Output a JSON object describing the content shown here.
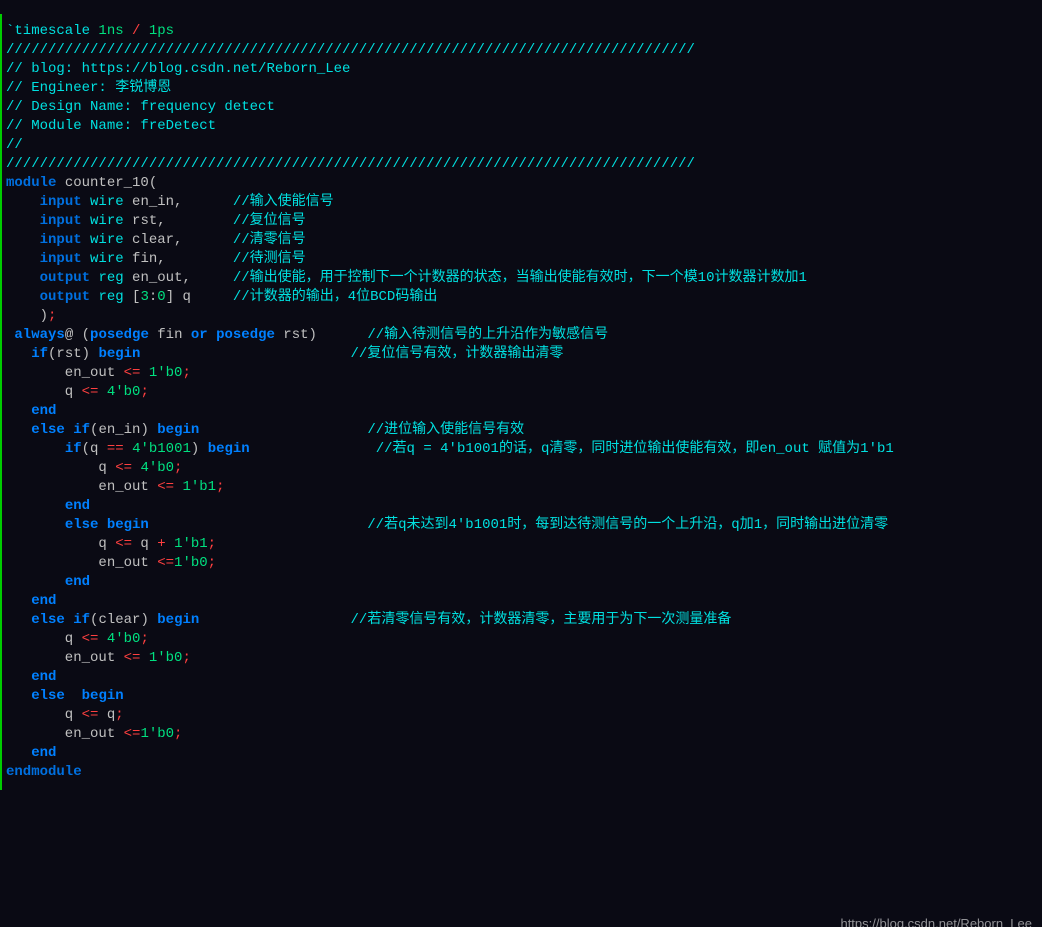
{
  "watermark": "https://blog.csdn.net/Reborn_Lee",
  "lines": [
    [
      [
        "tick",
        "`timescale "
      ],
      [
        "num",
        "1ns"
      ],
      [
        "pl",
        " "
      ],
      [
        "op",
        "/"
      ],
      [
        "pl",
        " "
      ],
      [
        "num",
        "1ps"
      ]
    ],
    [
      [
        "cm",
        "//////////////////////////////////////////////////////////////////////////////////"
      ]
    ],
    [
      [
        "cm",
        "// blog: https://blog.csdn.net/Reborn_Lee"
      ]
    ],
    [
      [
        "cm",
        "// Engineer: 李锐博恩"
      ]
    ],
    [
      [
        "cm",
        "// Design Name: frequency detect"
      ]
    ],
    [
      [
        "cm",
        "// Module Name: freDetect"
      ]
    ],
    [
      [
        "cm",
        "//"
      ]
    ],
    [
      [
        "cm",
        "//////////////////////////////////////////////////////////////////////////////////"
      ]
    ],
    [
      [
        "pl",
        ""
      ]
    ],
    [
      [
        "pl",
        ""
      ]
    ],
    [
      [
        "pl",
        ""
      ]
    ],
    [
      [
        "kw1",
        "module"
      ],
      [
        "pl",
        " counter_10("
      ]
    ],
    [
      [
        "pl",
        ""
      ]
    ],
    [
      [
        "pl",
        "    "
      ],
      [
        "kw1",
        "input"
      ],
      [
        "pl",
        " "
      ],
      [
        "kw2",
        "wire"
      ],
      [
        "pl",
        " en_in,      "
      ],
      [
        "cm",
        "//输入使能信号"
      ]
    ],
    [
      [
        "pl",
        "    "
      ],
      [
        "kw1",
        "input"
      ],
      [
        "pl",
        " "
      ],
      [
        "kw2",
        "wire"
      ],
      [
        "pl",
        " rst,        "
      ],
      [
        "cm",
        "//复位信号"
      ]
    ],
    [
      [
        "pl",
        "    "
      ],
      [
        "kw1",
        "input"
      ],
      [
        "pl",
        " "
      ],
      [
        "kw2",
        "wire"
      ],
      [
        "pl",
        " clear,      "
      ],
      [
        "cm",
        "//清零信号"
      ]
    ],
    [
      [
        "pl",
        "    "
      ],
      [
        "kw1",
        "input"
      ],
      [
        "pl",
        " "
      ],
      [
        "kw2",
        "wire"
      ],
      [
        "pl",
        " fin,        "
      ],
      [
        "cm",
        "//待测信号"
      ]
    ],
    [
      [
        "pl",
        "    "
      ],
      [
        "kw1",
        "output"
      ],
      [
        "pl",
        " "
      ],
      [
        "kw2",
        "reg"
      ],
      [
        "pl",
        " en_out,     "
      ],
      [
        "cm",
        "//输出使能，用于控制下一个计数器的状态，当输出使能有效时，下一个模10计数器计数加1"
      ]
    ],
    [
      [
        "pl",
        "    "
      ],
      [
        "kw1",
        "output"
      ],
      [
        "pl",
        " "
      ],
      [
        "kw2",
        "reg"
      ],
      [
        "pl",
        " ["
      ],
      [
        "num",
        "3"
      ],
      [
        "pl",
        ":"
      ],
      [
        "num",
        "0"
      ],
      [
        "pl",
        "] q     "
      ],
      [
        "cm",
        "//计数器的输出，4位BCD码输出"
      ]
    ],
    [
      [
        "pl",
        ""
      ]
    ],
    [
      [
        "pl",
        "    )"
      ],
      [
        "op",
        ";"
      ]
    ],
    [
      [
        "pl",
        ""
      ]
    ],
    [
      [
        "pl",
        " "
      ],
      [
        "kw3",
        "always"
      ],
      [
        "pl",
        "@ ("
      ],
      [
        "kw3",
        "posedge"
      ],
      [
        "pl",
        " fin "
      ],
      [
        "kw3",
        "or"
      ],
      [
        "pl",
        " "
      ],
      [
        "kw3",
        "posedge"
      ],
      [
        "pl",
        " rst)      "
      ],
      [
        "cm",
        "//输入待测信号的上升沿作为敏感信号"
      ]
    ],
    [
      [
        "pl",
        "   "
      ],
      [
        "kw3",
        "if"
      ],
      [
        "pl",
        "(rst) "
      ],
      [
        "kw3",
        "begin"
      ],
      [
        "pl",
        "                         "
      ],
      [
        "cm",
        "//复位信号有效，计数器输出清零"
      ]
    ],
    [
      [
        "pl",
        "       en_out "
      ],
      [
        "op",
        "<="
      ],
      [
        "pl",
        " "
      ],
      [
        "num",
        "1'b0"
      ],
      [
        "op",
        ";"
      ]
    ],
    [
      [
        "pl",
        "       q "
      ],
      [
        "op",
        "<="
      ],
      [
        "pl",
        " "
      ],
      [
        "num",
        "4'b0"
      ],
      [
        "op",
        ";"
      ]
    ],
    [
      [
        "pl",
        "   "
      ],
      [
        "kw3",
        "end"
      ]
    ],
    [
      [
        "pl",
        "   "
      ],
      [
        "kw3",
        "else"
      ],
      [
        "pl",
        " "
      ],
      [
        "kw3",
        "if"
      ],
      [
        "pl",
        "(en_in) "
      ],
      [
        "kw3",
        "begin"
      ],
      [
        "pl",
        "                    "
      ],
      [
        "cm",
        "//进位输入使能信号有效"
      ]
    ],
    [
      [
        "pl",
        "       "
      ],
      [
        "kw3",
        "if"
      ],
      [
        "pl",
        "(q "
      ],
      [
        "op",
        "=="
      ],
      [
        "pl",
        " "
      ],
      [
        "num",
        "4'b1001"
      ],
      [
        "pl",
        ") "
      ],
      [
        "kw3",
        "begin"
      ],
      [
        "pl",
        "               "
      ],
      [
        "cm",
        "//若q = 4'b1001的话，q清零，同时进位输出使能有效，即en_out 赋值为1'b1"
      ]
    ],
    [
      [
        "pl",
        "           q "
      ],
      [
        "op",
        "<="
      ],
      [
        "pl",
        " "
      ],
      [
        "num",
        "4'b0"
      ],
      [
        "op",
        ";"
      ]
    ],
    [
      [
        "pl",
        "           en_out "
      ],
      [
        "op",
        "<="
      ],
      [
        "pl",
        " "
      ],
      [
        "num",
        "1'b1"
      ],
      [
        "op",
        ";"
      ]
    ],
    [
      [
        "pl",
        "       "
      ],
      [
        "kw3",
        "end"
      ]
    ],
    [
      [
        "pl",
        "       "
      ],
      [
        "kw3",
        "else"
      ],
      [
        "pl",
        " "
      ],
      [
        "kw3",
        "begin"
      ],
      [
        "pl",
        "                          "
      ],
      [
        "cm",
        "//若q未达到4'b1001时，每到达待测信号的一个上升沿，q加1，同时输出进位清零"
      ]
    ],
    [
      [
        "pl",
        "           q "
      ],
      [
        "op",
        "<="
      ],
      [
        "pl",
        " q "
      ],
      [
        "op",
        "+"
      ],
      [
        "pl",
        " "
      ],
      [
        "num",
        "1'b1"
      ],
      [
        "op",
        ";"
      ]
    ],
    [
      [
        "pl",
        "           en_out "
      ],
      [
        "op",
        "<="
      ],
      [
        "num",
        "1'b0"
      ],
      [
        "op",
        ";"
      ]
    ],
    [
      [
        "pl",
        "       "
      ],
      [
        "kw3",
        "end"
      ]
    ],
    [
      [
        "pl",
        "   "
      ],
      [
        "kw3",
        "end"
      ]
    ],
    [
      [
        "pl",
        "   "
      ],
      [
        "kw3",
        "else"
      ],
      [
        "pl",
        " "
      ],
      [
        "kw3",
        "if"
      ],
      [
        "pl",
        "(clear) "
      ],
      [
        "kw3",
        "begin"
      ],
      [
        "pl",
        "                  "
      ],
      [
        "cm",
        "//若清零信号有效，计数器清零，主要用于为下一次测量准备"
      ]
    ],
    [
      [
        "pl",
        "       q "
      ],
      [
        "op",
        "<="
      ],
      [
        "pl",
        " "
      ],
      [
        "num",
        "4'b0"
      ],
      [
        "op",
        ";"
      ]
    ],
    [
      [
        "pl",
        "       en_out "
      ],
      [
        "op",
        "<="
      ],
      [
        "pl",
        " "
      ],
      [
        "num",
        "1'b0"
      ],
      [
        "op",
        ";"
      ]
    ],
    [
      [
        "pl",
        "   "
      ],
      [
        "kw3",
        "end"
      ]
    ],
    [
      [
        "pl",
        "   "
      ],
      [
        "kw3",
        "else"
      ],
      [
        "pl",
        "  "
      ],
      [
        "kw3",
        "begin"
      ]
    ],
    [
      [
        "pl",
        "       q "
      ],
      [
        "op",
        "<="
      ],
      [
        "pl",
        " q"
      ],
      [
        "op",
        ";"
      ]
    ],
    [
      [
        "pl",
        "       en_out "
      ],
      [
        "op",
        "<="
      ],
      [
        "num",
        "1'b0"
      ],
      [
        "op",
        ";"
      ]
    ],
    [
      [
        "pl",
        "   "
      ],
      [
        "kw3",
        "end"
      ]
    ],
    [
      [
        "pl",
        ""
      ]
    ],
    [
      [
        "pl",
        ""
      ]
    ],
    [
      [
        "kw1",
        "endmodule"
      ]
    ]
  ]
}
